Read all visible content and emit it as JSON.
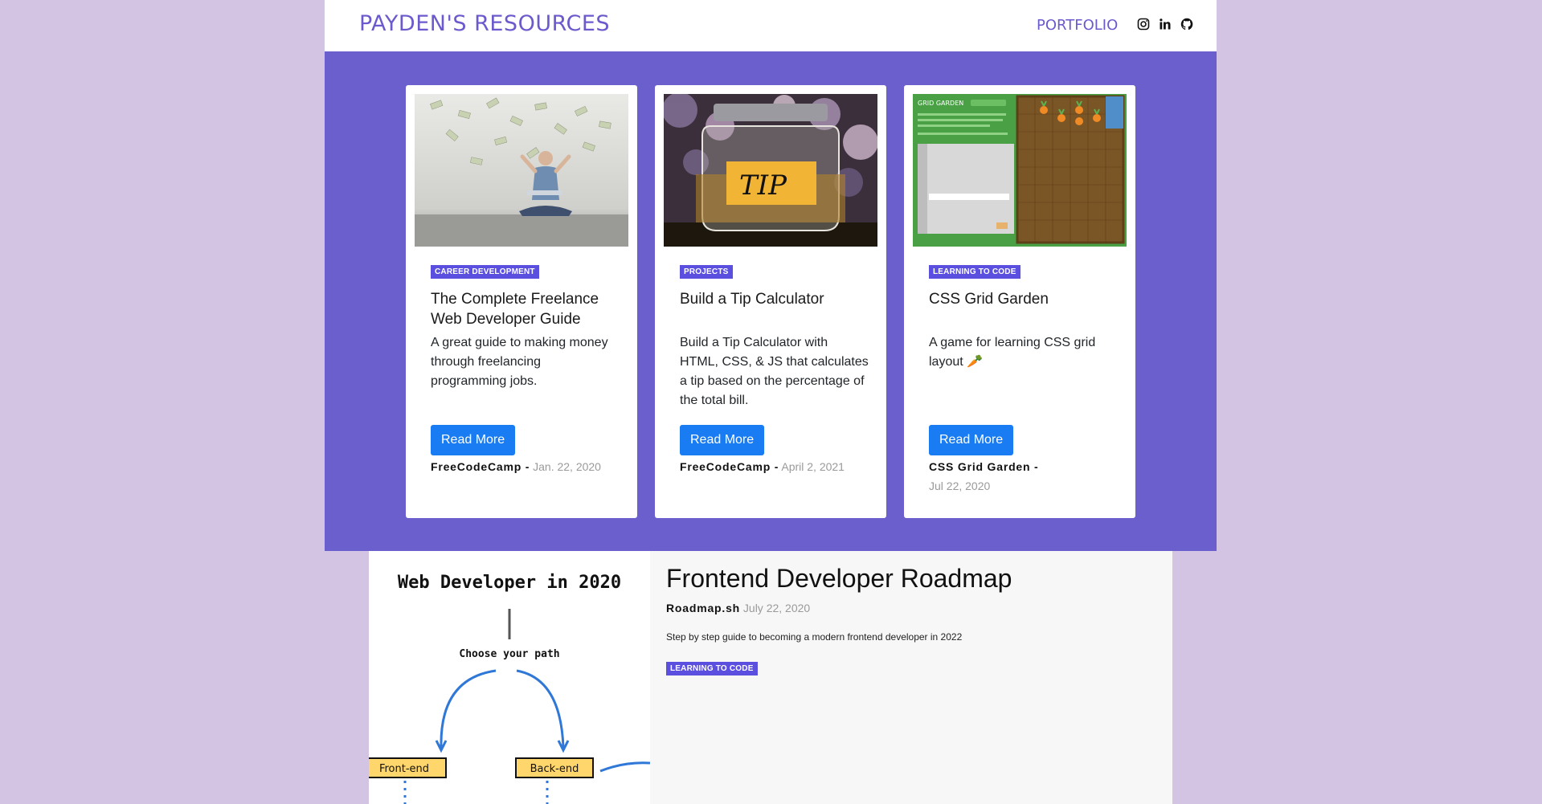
{
  "header": {
    "brand": "PAYDEN'S RESOURCES",
    "portfolio_link": "PORTFOLIO",
    "social_icons": [
      "instagram-icon",
      "linkedin-icon",
      "github-icon"
    ]
  },
  "colors": {
    "brand": "#6a5acd",
    "band": "#6a5fcd",
    "badge": "#5b4fe0",
    "button": "#1a7cf2",
    "page_bg": "#d2c4e2"
  },
  "cards": [
    {
      "category": "CAREER DEVELOPMENT",
      "title": "The Complete Freelance Web Developer Guide",
      "description": "A great guide to making money through freelancing programming jobs.",
      "button": "Read More",
      "source": "FreeCodeCamp -",
      "date": "Jan. 22, 2020"
    },
    {
      "category": "PROJECTS",
      "title": "Build a Tip Calculator",
      "description": "Build a Tip Calculator with HTML, CSS, & JS that calculates a tip based on the percentage of the total bill.",
      "button": "Read More",
      "source": "FreeCodeCamp -",
      "date": "April 2, 2021",
      "image_text": "TIP"
    },
    {
      "category": "LEARNING TO CODE",
      "title": "CSS Grid Garden",
      "description": "A game for learning CSS grid layout 🥕",
      "button": "Read More",
      "source": "CSS Grid Garden -",
      "date": "Jul 22, 2020",
      "image_text": "GRID GARDEN"
    }
  ],
  "feature": {
    "title": "Frontend Developer Roadmap",
    "source": "Roadmap.sh",
    "date": "July 22, 2020",
    "description": "Step by step guide to becoming a modern frontend developer in 2022",
    "category": "LEARNING TO CODE",
    "art": {
      "heading": "Web Developer in 2020",
      "prompt": "Choose your path",
      "left_box": "Front-end",
      "right_box": "Back-end"
    }
  }
}
